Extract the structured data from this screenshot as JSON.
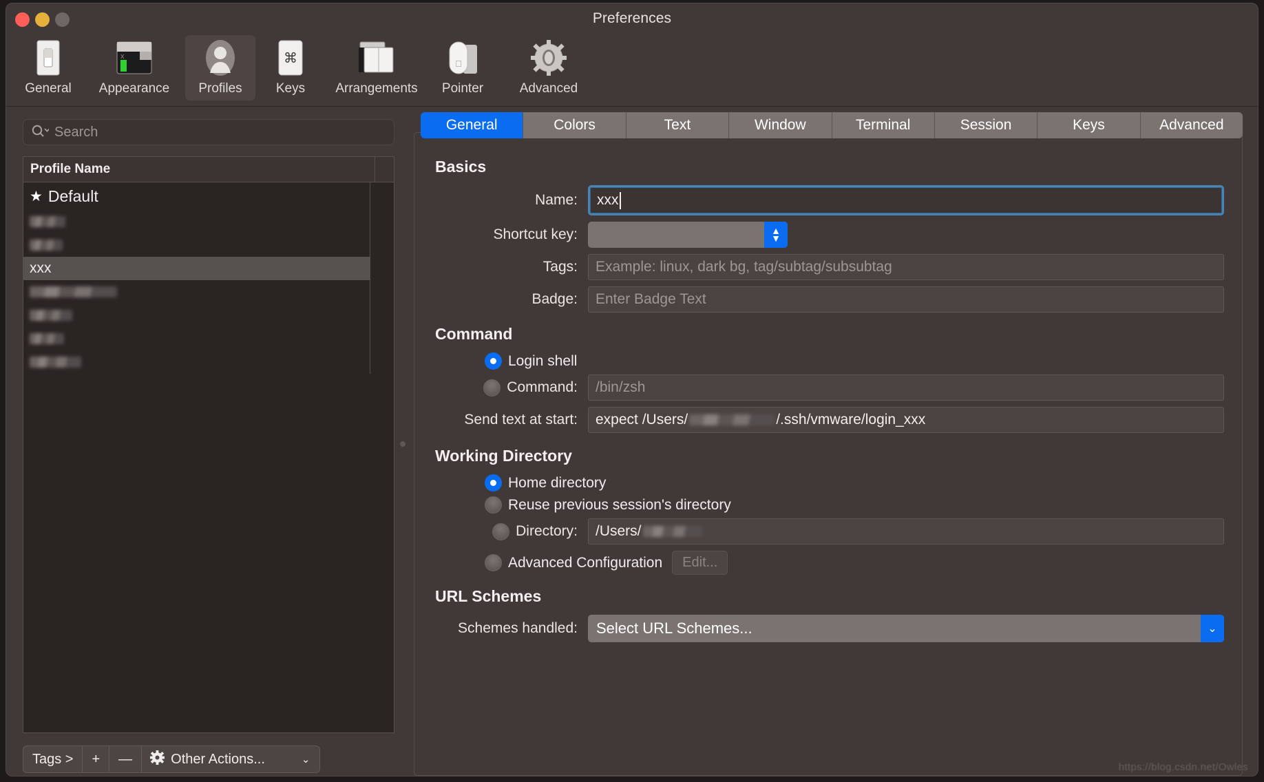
{
  "window": {
    "title": "Preferences"
  },
  "toolbar": {
    "items": [
      {
        "label": "General",
        "icon": "general-switch-icon"
      },
      {
        "label": "Appearance",
        "icon": "appearance-window-icon"
      },
      {
        "label": "Profiles",
        "icon": "profiles-person-icon"
      },
      {
        "label": "Keys",
        "icon": "keys-command-icon"
      },
      {
        "label": "Arrangements",
        "icon": "arrangements-windows-icon"
      },
      {
        "label": "Pointer",
        "icon": "pointer-mouse-icon"
      },
      {
        "label": "Advanced",
        "icon": "advanced-gear-icon"
      }
    ],
    "selected": "Profiles"
  },
  "sidebar": {
    "search": {
      "placeholder": "Search",
      "value": ""
    },
    "list": {
      "column_header": "Profile Name",
      "rows": [
        {
          "label": "Default",
          "starred": true,
          "redacted": false,
          "selected": false
        },
        {
          "label": "",
          "starred": false,
          "redacted": true,
          "selected": false,
          "blur_width": 52
        },
        {
          "label": "",
          "starred": false,
          "redacted": true,
          "selected": false,
          "blur_width": 48
        },
        {
          "label": "xxx",
          "starred": false,
          "redacted": false,
          "selected": true
        },
        {
          "label": "",
          "starred": false,
          "redacted": true,
          "selected": false,
          "blur_width": 127
        },
        {
          "label": "",
          "starred": false,
          "redacted": true,
          "selected": false,
          "blur_width": 62
        },
        {
          "label": "",
          "starred": false,
          "redacted": true,
          "selected": false,
          "blur_width": 50
        },
        {
          "label": "",
          "starred": false,
          "redacted": true,
          "selected": false,
          "blur_width": 75
        }
      ]
    },
    "bottom_bar": {
      "tags_label": "Tags >",
      "add_label": "+",
      "remove_label": "—",
      "other_actions_label": "Other Actions...",
      "other_actions_caret": "⌄",
      "gear_icon": "gear-icon"
    }
  },
  "tabs": [
    {
      "label": "General",
      "active": true
    },
    {
      "label": "Colors",
      "active": false
    },
    {
      "label": "Text",
      "active": false
    },
    {
      "label": "Window",
      "active": false
    },
    {
      "label": "Terminal",
      "active": false
    },
    {
      "label": "Session",
      "active": false
    },
    {
      "label": "Keys",
      "active": false
    },
    {
      "label": "Advanced",
      "active": false
    }
  ],
  "general": {
    "basics": {
      "title": "Basics",
      "name_label": "Name:",
      "name_value": "xxx",
      "shortcut_label": "Shortcut key:",
      "shortcut_value": "",
      "tags_label": "Tags:",
      "tags_placeholder": "Example: linux, dark bg, tag/subtag/subsubtag",
      "badge_label": "Badge:",
      "badge_placeholder": "Enter Badge Text"
    },
    "command": {
      "title": "Command",
      "login_shell_label": "Login shell",
      "login_shell_selected": true,
      "command_label": "Command:",
      "command_selected": false,
      "command_placeholder": "/bin/zsh",
      "send_text_label": "Send text at start:",
      "send_text_prefix": "expect /Users/",
      "send_text_suffix": "/.ssh/vmware/login_xxx"
    },
    "working_directory": {
      "title": "Working Directory",
      "home_label": "Home directory",
      "home_selected": true,
      "reuse_label": "Reuse previous session's directory",
      "reuse_selected": false,
      "directory_label": "Directory:",
      "directory_selected": false,
      "directory_prefix": "/Users/",
      "advanced_label": "Advanced Configuration",
      "advanced_selected": false,
      "edit_button_label": "Edit..."
    },
    "url_schemes": {
      "title": "URL Schemes",
      "schemes_label": "Schemes handled:",
      "schemes_value": "Select URL Schemes...",
      "schemes_caret": "⌄"
    }
  },
  "watermark": {
    "text": "https://blog.csdn.net/Owles"
  },
  "colors": {
    "accent_blue": "#0a6cf0",
    "window_bg": "#413937",
    "list_bg": "#2a2423",
    "selected_row": "#575150",
    "tab_inactive": "#7b7370"
  }
}
